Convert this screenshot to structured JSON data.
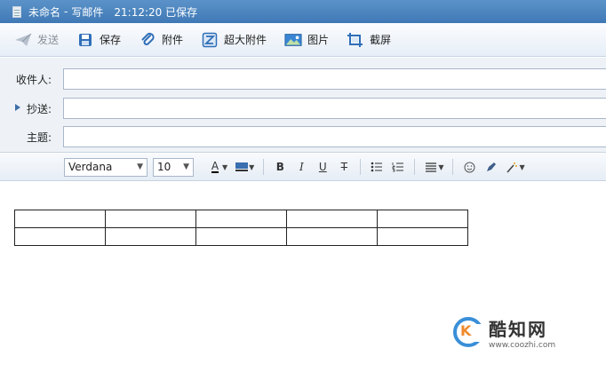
{
  "titlebar": {
    "doc_name": "未命名",
    "separator": "-",
    "mode": "写邮件",
    "saved_status": "21:12:20 已保存"
  },
  "toolbar": {
    "send_label": "发送",
    "save_label": "保存",
    "attach_label": "附件",
    "large_attach_label": "超大附件",
    "image_label": "图片",
    "screenshot_label": "截屏"
  },
  "fields": {
    "to_label": "收件人:",
    "cc_label": "抄送:",
    "subject_label": "主题:",
    "to_value": "",
    "cc_value": "",
    "subject_value": ""
  },
  "format": {
    "font_family": "Verdana",
    "font_size": "10",
    "bold": "B",
    "italic": "I",
    "underline": "U",
    "strike": "T",
    "font_color": "A"
  },
  "editor": {
    "table": {
      "rows": 2,
      "cols": 5
    }
  },
  "watermark": {
    "logo_letter": "K",
    "name": "酷知网",
    "url": "www.coozhi.com"
  },
  "colors": {
    "titlebar": "#4a86c2",
    "accent": "#2f6fb8",
    "border": "#a9b7c8"
  }
}
